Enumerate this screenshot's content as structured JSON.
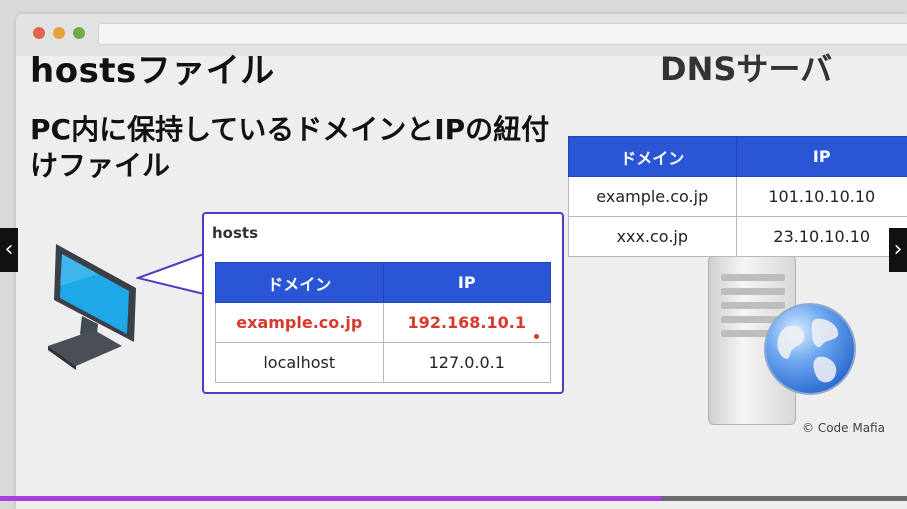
{
  "slide": {
    "title": "hostsファイル",
    "subtitle": "PC内に保持しているドメインとIPの紐付けファイル",
    "dns_title": "DNSサーバ"
  },
  "dns_table": {
    "headers": [
      "ドメイン",
      "IP"
    ],
    "rows": [
      [
        "example.co.jp",
        "101.10.10.10"
      ],
      [
        "xxx.co.jp",
        "23.10.10.10"
      ]
    ]
  },
  "hosts": {
    "label": "hosts",
    "headers": [
      "ドメイン",
      "IP"
    ],
    "rows": [
      [
        "example.co.jp",
        "192.168.10.1"
      ],
      [
        "localhost",
        "127.0.0.1"
      ]
    ]
  },
  "footer": {
    "copyright": "© Code Mafia"
  },
  "player": {
    "progress_percent": 73,
    "prev_glyph": "‹",
    "next_glyph": "›"
  },
  "icons": [
    "monitor-icon",
    "server-icon",
    "globe-icon"
  ],
  "colors": {
    "table_header": "#2a56d6",
    "highlight_text": "#d63a2a",
    "bubble_border": "#4a3fc0",
    "progress": "#a43fe0"
  }
}
